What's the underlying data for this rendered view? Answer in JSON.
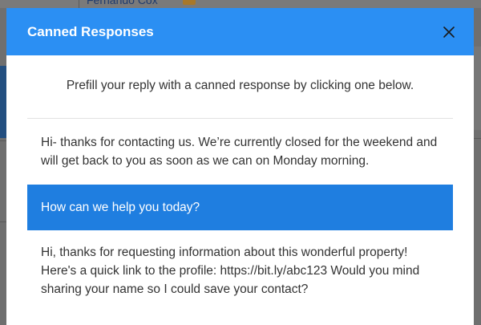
{
  "background": {
    "contact_name": "Fernando Cox"
  },
  "modal": {
    "title": "Canned Responses",
    "close_icon": "close-icon",
    "intro": "Prefill your reply with a canned response by clicking one below.",
    "responses": [
      {
        "text": "Hi- thanks for contacting us. We’re currently closed for the weekend and will get back to you as soon as we can on Monday morning.",
        "selected": false
      },
      {
        "text": "How can we help you today?",
        "selected": true
      },
      {
        "text": "Hi, thanks for requesting information about this wonderful property! Here's a quick link to the profile: https://bit.ly/abc123 Would you mind sharing your name so I could save your contact?",
        "selected": false
      }
    ]
  },
  "colors": {
    "header": "#2b8ff3",
    "selected_row": "#1f7ee0",
    "overlay": "#6f6f6f"
  }
}
